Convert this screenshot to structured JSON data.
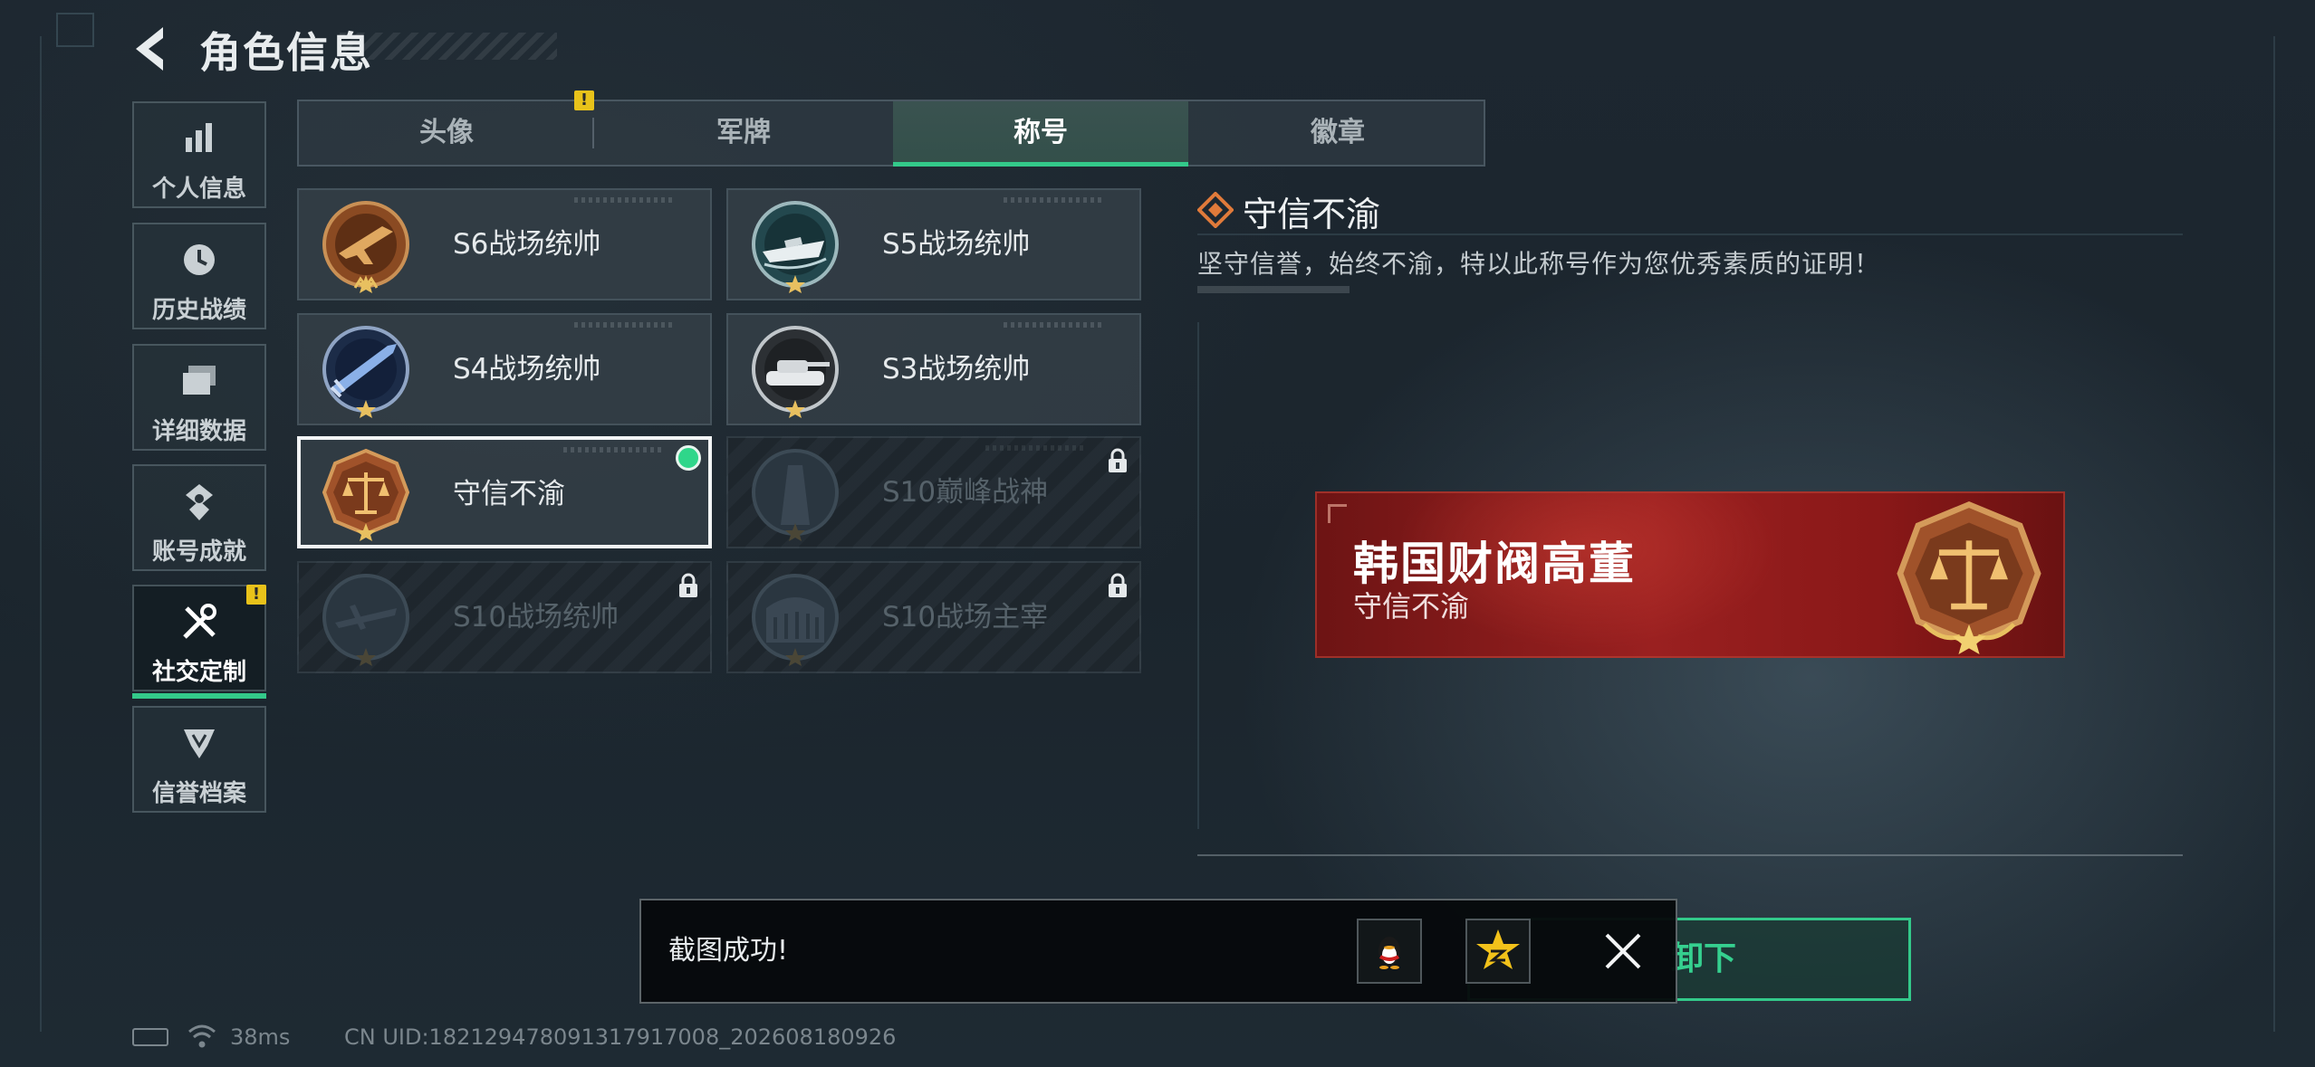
{
  "header": {
    "title": "角色信息",
    "back_icon": "back-arrow-icon"
  },
  "sidebar": {
    "items": [
      {
        "label": "个人信息",
        "icon": "bar-chart-icon",
        "active": false,
        "alert": false
      },
      {
        "label": "历史战绩",
        "icon": "clock-icon",
        "active": false,
        "alert": false
      },
      {
        "label": "详细数据",
        "icon": "folders-icon",
        "active": false,
        "alert": false
      },
      {
        "label": "账号成就",
        "icon": "achievement-icon",
        "active": false,
        "alert": false
      },
      {
        "label": "社交定制",
        "icon": "wrench-screwdriver-icon",
        "active": true,
        "alert": true
      },
      {
        "label": "信誉档案",
        "icon": "credit-shield-icon",
        "active": false,
        "alert": false
      }
    ],
    "alert_mark": "!"
  },
  "tabs": [
    {
      "label": "头像",
      "active": false,
      "alert": true
    },
    {
      "label": "军牌",
      "active": false,
      "alert": false
    },
    {
      "label": "称号",
      "active": true,
      "alert": false
    },
    {
      "label": "徽章",
      "active": false,
      "alert": false
    }
  ],
  "titles": [
    {
      "name": "S6战场统帅",
      "medal": "jet-medal-icon",
      "locked": false,
      "selected": false
    },
    {
      "name": "S5战场统帅",
      "medal": "boat-medal-icon",
      "locked": false,
      "selected": false
    },
    {
      "name": "S4战场统帅",
      "medal": "missile-medal-icon",
      "locked": false,
      "selected": false
    },
    {
      "name": "S3战场统帅",
      "medal": "tank-medal-icon",
      "locked": false,
      "selected": false
    },
    {
      "name": "守信不渝",
      "medal": "scales-medal-icon",
      "locked": false,
      "selected": true
    },
    {
      "name": "S10巅峰战神",
      "medal": "tower-medal-icon",
      "locked": true,
      "selected": false
    },
    {
      "name": "S10战场统帅",
      "medal": "aircraft-medal-icon",
      "locked": true,
      "selected": false
    },
    {
      "name": "S10战场主宰",
      "medal": "colosseum-medal-icon",
      "locked": true,
      "selected": false
    }
  ],
  "detail": {
    "title": "守信不渝",
    "description": "坚守信誉，始终不渝，特以此称号作为您优秀素质的证明！"
  },
  "nameplate": {
    "player_name": "韩国财阀高董",
    "title": "守信不渝",
    "emblem": "scales-emblem-icon",
    "colors": {
      "primary": "#9a2020",
      "dark": "#6a1212"
    }
  },
  "action": {
    "unequip_label": "卸下"
  },
  "toast": {
    "message": "截图成功!",
    "share_icons": [
      "qq-penguin-icon",
      "qzone-star-icon"
    ],
    "close_icon": "close-icon"
  },
  "status_bar": {
    "ping": "38ms",
    "uid": "CN UID:18212947809131791700​8_202608180926"
  },
  "accent_color": "#33c98a"
}
